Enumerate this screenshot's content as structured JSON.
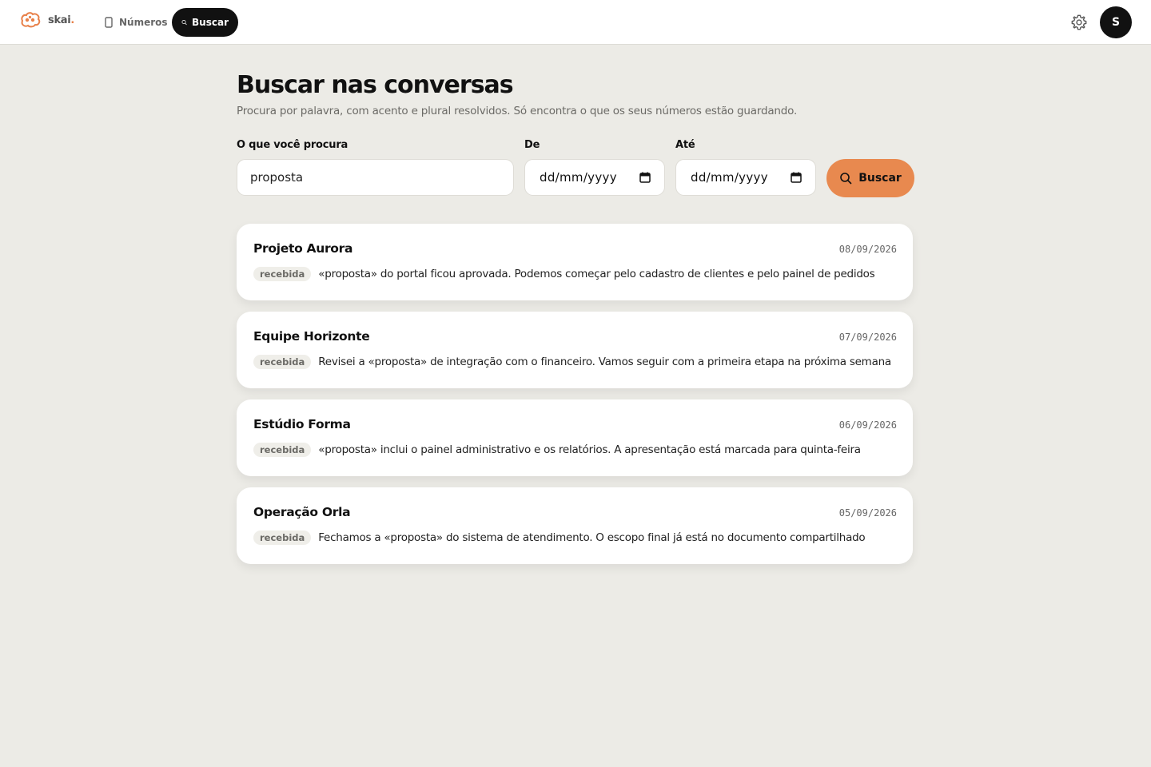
{
  "app": {
    "logo_text": "skai",
    "logo_dot": ".",
    "nav": {
      "numeros_label": "Números",
      "buscar_label": "Buscar"
    },
    "user_initial": "S"
  },
  "page": {
    "title": "Buscar nas conversas",
    "subtitle": "Procura por palavra, com acento e plural resolvidos. Só encontra o que os seus números estão guardando."
  },
  "form": {
    "query_label": "O que você procura",
    "query_value": "proposta",
    "from_label": "De",
    "from_placeholder": "dd/mm/yyyy",
    "to_label": "Até",
    "to_placeholder": "dd/mm/yyyy",
    "submit_label": "Buscar"
  },
  "results": [
    {
      "title": "Projeto Aurora",
      "date": "08/09/2026",
      "badge": "recebida",
      "snippet": "«proposta» do portal ficou aprovada. Podemos começar pelo cadastro de clientes e pelo painel de pedidos"
    },
    {
      "title": "Equipe Horizonte",
      "date": "07/09/2026",
      "badge": "recebida",
      "snippet": "Revisei a «proposta» de integração com o financeiro. Vamos seguir com a primeira etapa na próxima semana"
    },
    {
      "title": "Estúdio Forma",
      "date": "06/09/2026",
      "badge": "recebida",
      "snippet": "«proposta» inclui o painel administrativo e os relatórios. A apresentação está marcada para quinta-feira"
    },
    {
      "title": "Operação Orla",
      "date": "05/09/2026",
      "badge": "recebida",
      "snippet": "Fechamos a «proposta» do sistema de atendimento. O escopo final já está no documento compartilhado"
    }
  ],
  "colors": {
    "accent": "#e8894f",
    "background": "#ecebe6",
    "dark": "#111111"
  }
}
